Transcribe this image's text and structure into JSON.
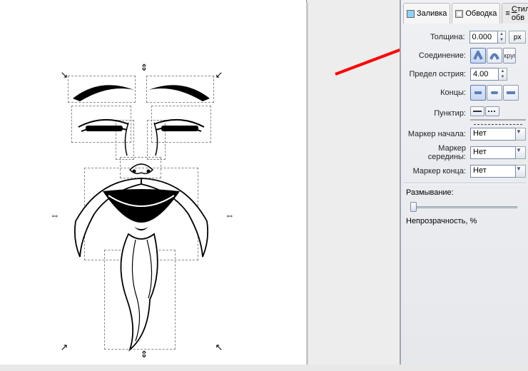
{
  "tabs": {
    "fill": "Заливка",
    "stroke": "Обводка",
    "style": "Стиль обв",
    "style_underline_char": "С"
  },
  "stroke_panel": {
    "width_label": "Толщина:",
    "width_value": "0.000",
    "unit": "px",
    "join_label": "Соединение:",
    "miter_label": "Предел острия:",
    "miter_value": "4.00",
    "caps_label": "Концы:",
    "dash_label": "Пунктир:",
    "marker_start_label": "Маркер начала:",
    "marker_mid_label": "Маркер середины:",
    "marker_end_label": "Маркер конца:",
    "marker_none": "Нет"
  },
  "extras": {
    "blur_label": "Размывание:",
    "opacity_label": "Непрозрачность, %"
  },
  "colors": {
    "panel_bg": "#e9ebf0",
    "accent": "#6d8fc2",
    "arrow": "#ff0000"
  }
}
